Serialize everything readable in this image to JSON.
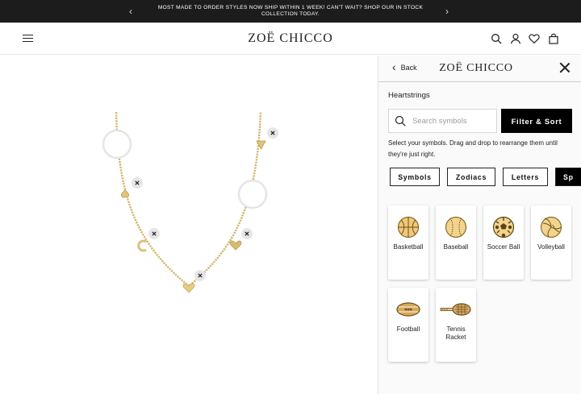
{
  "announcement": {
    "message": "MOST MADE TO ORDER STYLES NOW SHIP WITHIN 1 WEEK! CAN'T WAIT? SHOP OUR IN STOCK COLLECTION TODAY.",
    "prev_glyph": "‹",
    "next_glyph": "›"
  },
  "header": {
    "logo": "ZOË CHICCO",
    "icons": [
      "menu-icon",
      "search-icon",
      "account-icon",
      "heart-icon",
      "bag-icon"
    ]
  },
  "builder": {
    "remove_glyph": "✕",
    "colors": {
      "gold": "#dcc07a",
      "gold_dark": "#b99a4e"
    }
  },
  "panel": {
    "back_label": "Back",
    "logo": "ZOË CHICCO",
    "section_title": "Heartstrings",
    "search_placeholder": "Search symbols",
    "filter_label": "Filter & Sort",
    "help_text": "Select your symbols. Drag and drop to rearrange them until they're just right.",
    "tabs": [
      {
        "label": "Symbols"
      },
      {
        "label": "Zodiacs"
      },
      {
        "label": "Letters"
      },
      {
        "label": "Sp",
        "active": true
      }
    ],
    "symbols": [
      {
        "label": "Basketball",
        "icon": "basketball-icon"
      },
      {
        "label": "Baseball",
        "icon": "baseball-icon"
      },
      {
        "label": "Soccer Ball",
        "icon": "soccer-ball-icon"
      },
      {
        "label": "Volleyball",
        "icon": "volleyball-icon"
      },
      {
        "label": "Football",
        "icon": "football-icon"
      },
      {
        "label": "Tennis Racket",
        "icon": "tennis-racket-icon"
      }
    ]
  }
}
